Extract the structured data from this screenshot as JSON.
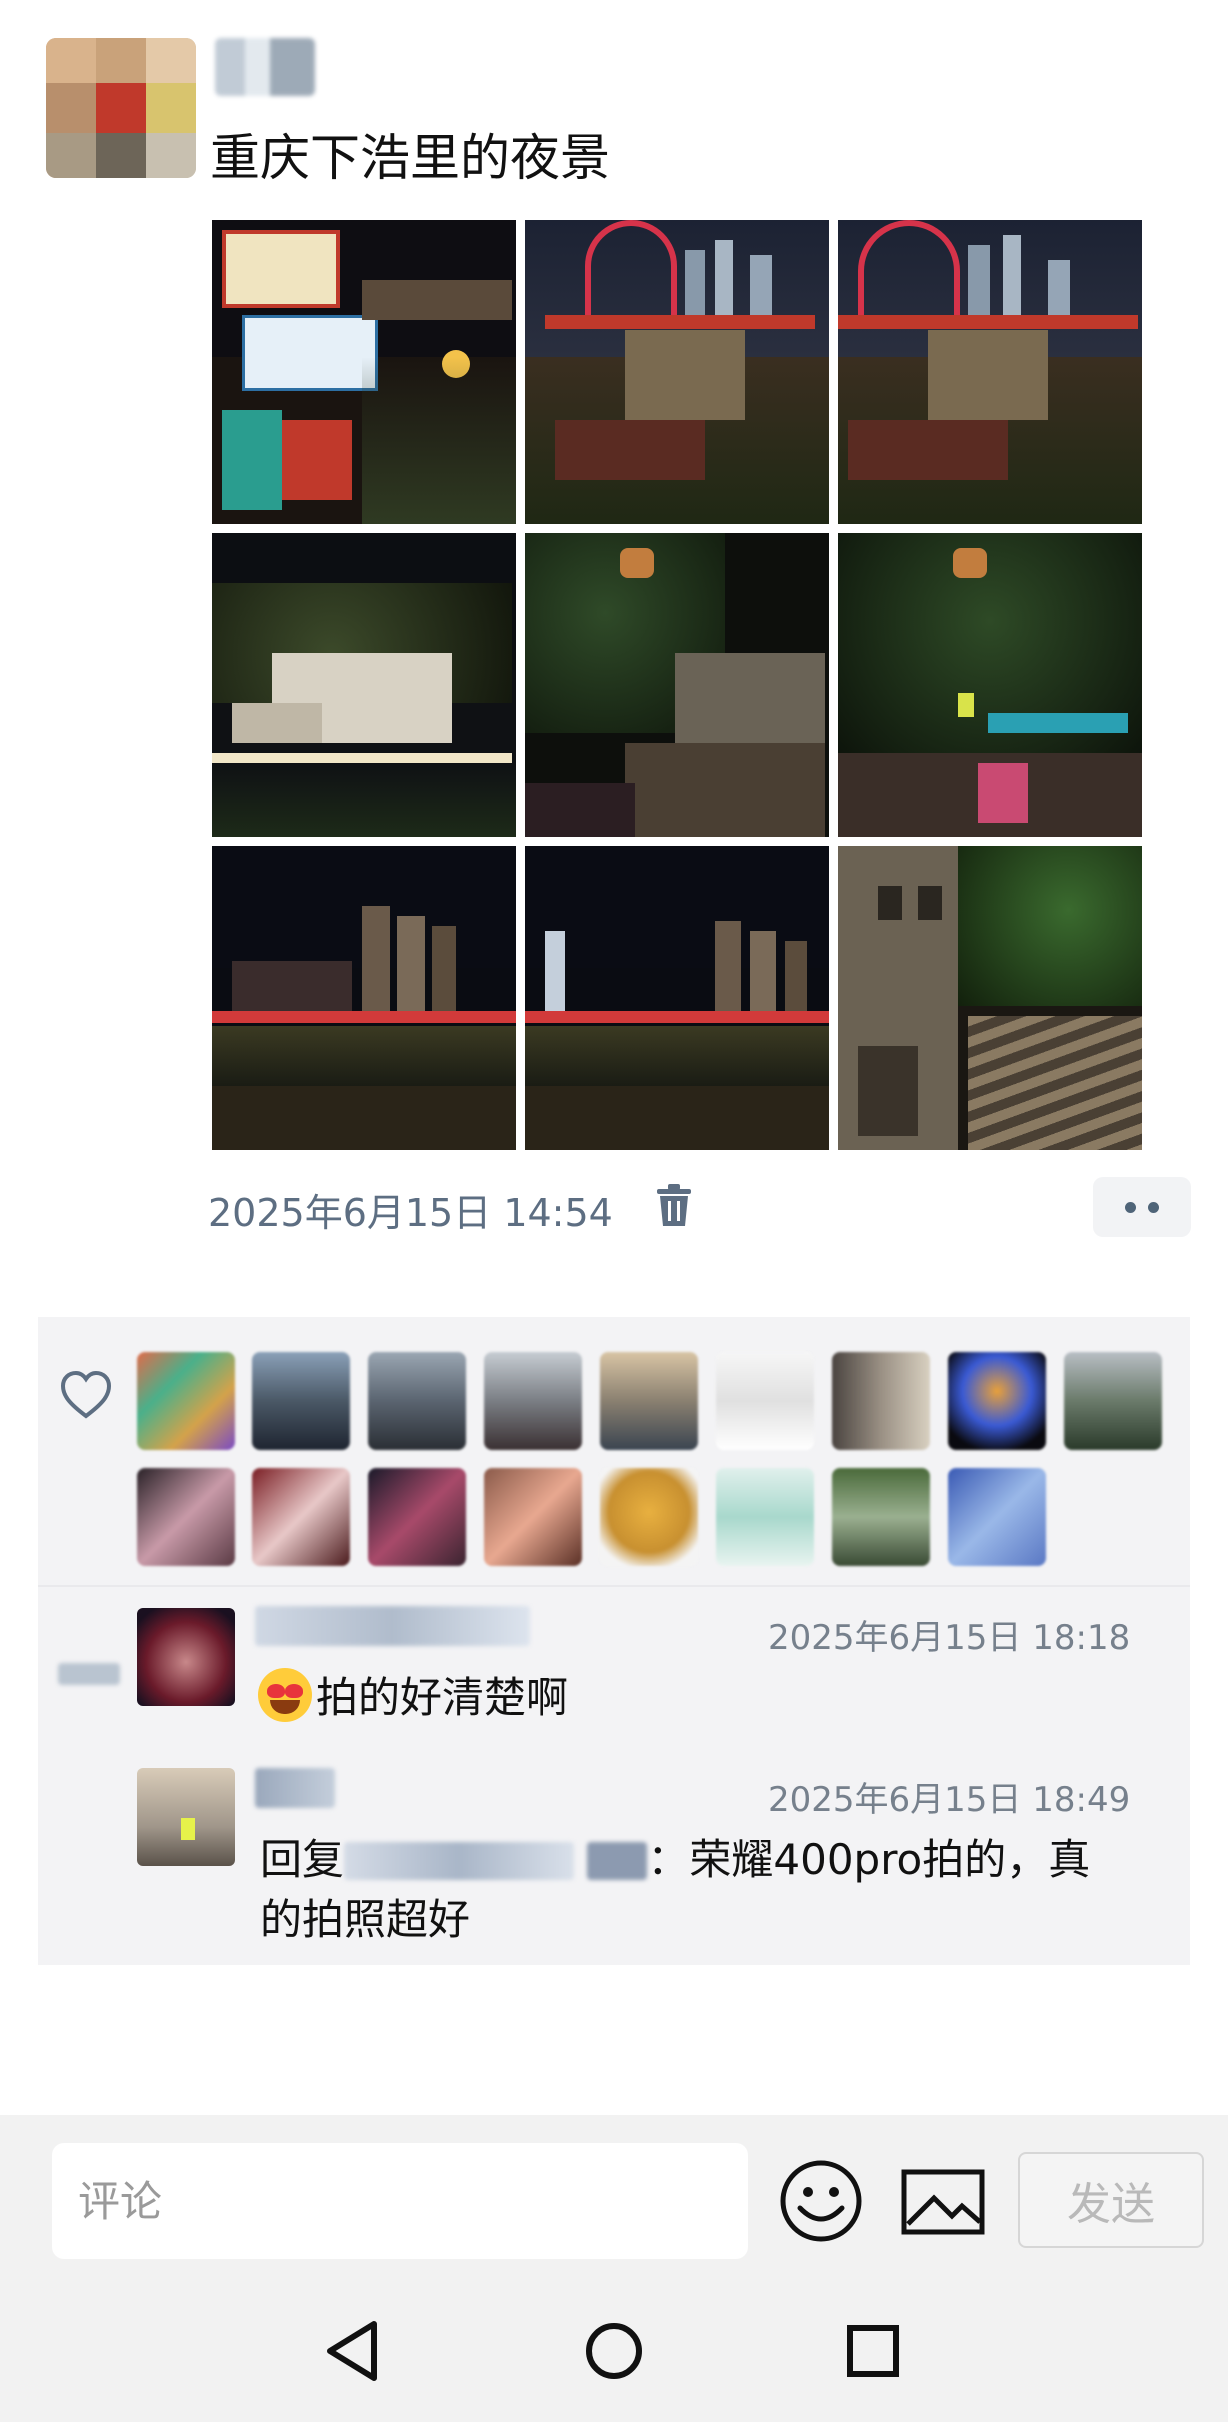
{
  "post": {
    "text": "重庆下浩里的夜景",
    "time": "2025年6月15日 14:54"
  },
  "photos": [
    {
      "icon": "photo-neon-signs"
    },
    {
      "icon": "photo-bridge-old-houses"
    },
    {
      "icon": "photo-bridge-old-houses-2"
    },
    {
      "icon": "photo-hillside-buildings"
    },
    {
      "icon": "photo-trees-rooftops"
    },
    {
      "icon": "photo-trees-lights"
    },
    {
      "icon": "photo-river-skyline"
    },
    {
      "icon": "photo-river-skyline-2"
    },
    {
      "icon": "photo-stairs-alley"
    }
  ],
  "likes": {
    "count_row1": 9,
    "count_row2": 8
  },
  "comments": [
    {
      "time": "2025年6月15日 18:18",
      "text": "拍的好清楚啊"
    },
    {
      "time": "2025年6月15日 18:49",
      "reply_prefix": "回复",
      "text_line1": "：荣耀400pro拍的，真",
      "text_line2": "的拍照超好"
    }
  ],
  "input": {
    "placeholder": "评论",
    "send_label": "发送"
  },
  "colors": {
    "accent": "#5d6e82",
    "panel": "#f3f3f5",
    "bar": "#f2f2f2"
  }
}
